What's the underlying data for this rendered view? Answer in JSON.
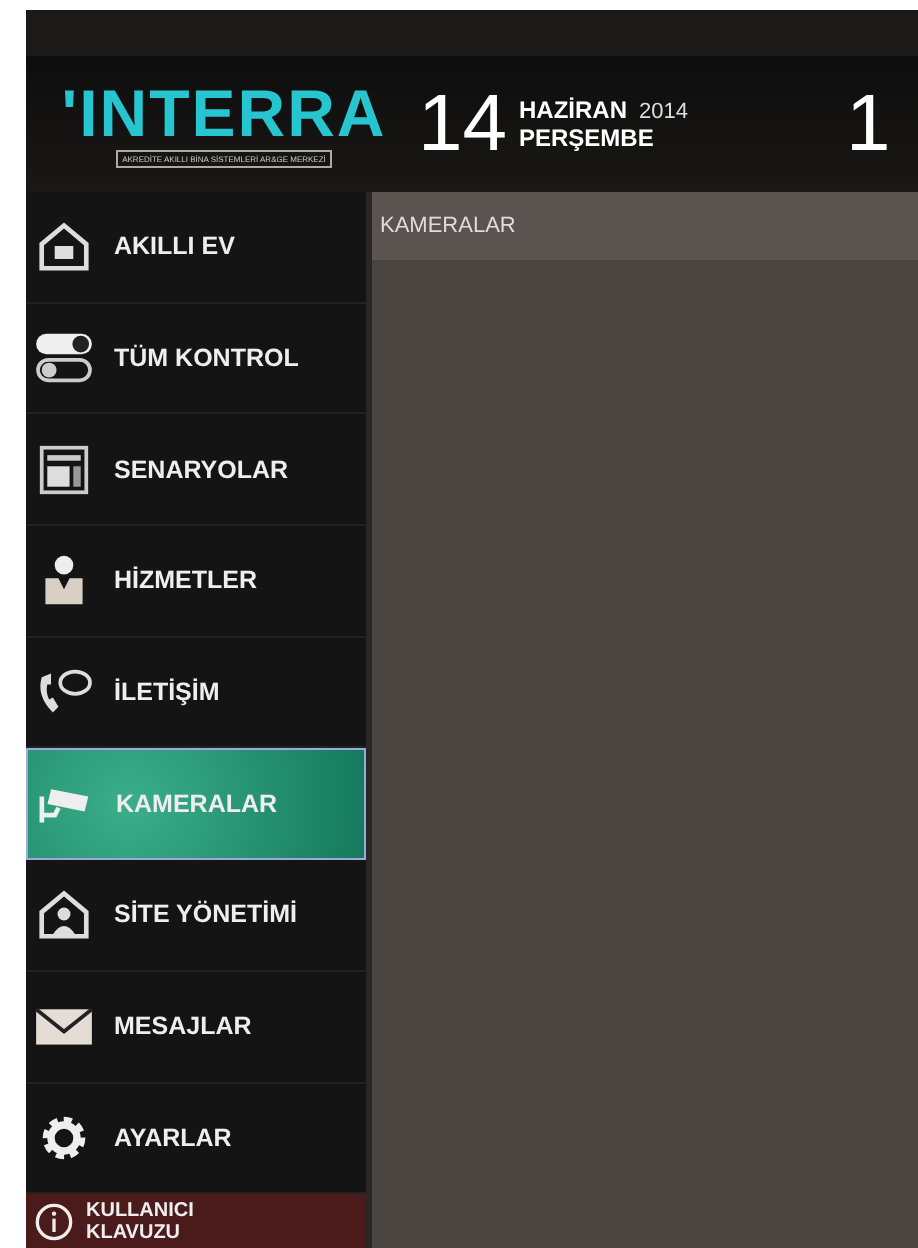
{
  "header": {
    "logo": "'INTERRA",
    "logo_tagline": "AKREDİTE AKILLI BİNA SİSTEMLERİ AR&GE MERKEZİ",
    "day": "14",
    "month": "HAZİRAN",
    "year": "2014",
    "weekday": "PERŞEMBE",
    "time": "1"
  },
  "sidebar": {
    "items": [
      {
        "label": "AKILLI EV",
        "selected": false
      },
      {
        "label": "TÜM KONTROL",
        "selected": false
      },
      {
        "label": "SENARYOLAR",
        "selected": false
      },
      {
        "label": "HİZMETLER",
        "selected": false
      },
      {
        "label": "İLETİŞİM",
        "selected": false
      },
      {
        "label": "KAMERALAR",
        "selected": true
      },
      {
        "label": "SİTE YÖNETİMİ",
        "selected": false
      },
      {
        "label": "MESAJLAR",
        "selected": false
      },
      {
        "label": "AYARLAR",
        "selected": false
      }
    ],
    "help": {
      "label": "KULLANICI KLAVUZU"
    }
  },
  "main": {
    "title": "KAMERALAR"
  }
}
